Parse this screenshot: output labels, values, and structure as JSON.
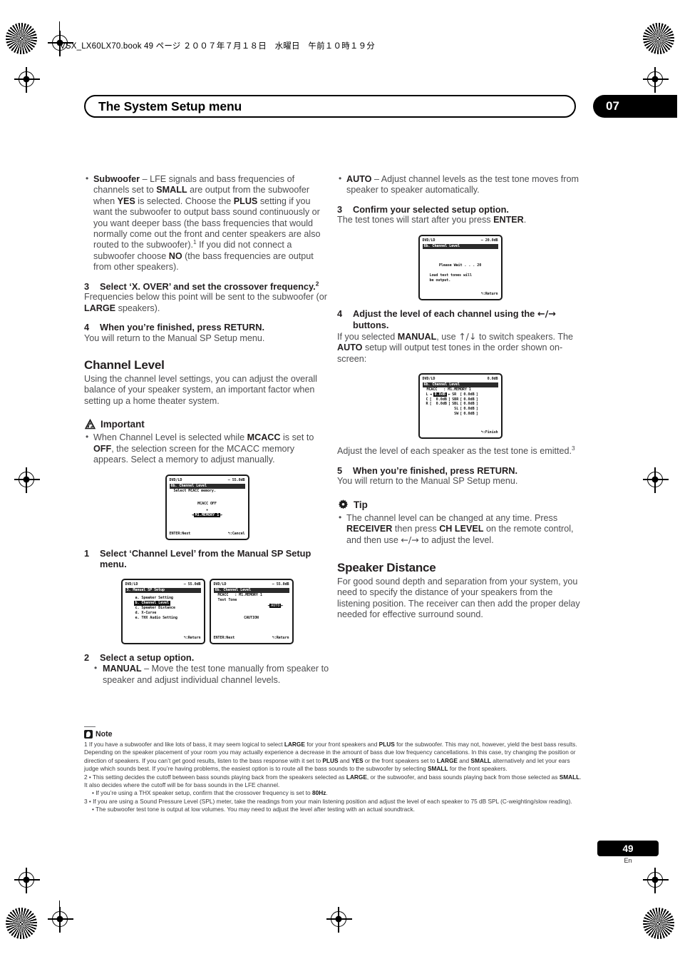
{
  "runhead": "VSX_LX60LX70.book 49 ページ ２００７年７月１８日　水曜日　午前１０時１９分",
  "header": {
    "title": "The System Setup menu",
    "chapter": "07"
  },
  "left_column": {
    "subwoofer_bullet": {
      "term": "Subwoofer",
      "text_1": " – LFE signals and bass frequencies of channels set to ",
      "b_small": "SMALL",
      "text_2": " are output from the subwoofer when ",
      "b_yes": "YES",
      "text_3": " is selected. Choose the ",
      "b_plus": "PLUS",
      "text_4": " setting if you want the subwoofer to output bass sound continuously or you want deeper bass (the bass frequencies that would normally come out the front and center speakers are also routed to the subwoofer).",
      "sup_1": "1",
      "text_5": " If you did not connect a subwoofer choose ",
      "b_no": "NO",
      "text_6": " (the bass frequencies are output from other speakers)."
    },
    "step3": {
      "num": "3",
      "title_a": "Select ‘X. OVER’ and set the crossover frequency.",
      "sup": "2",
      "body_1": "Frequencies below this point will be sent to the subwoofer (or ",
      "b_large": "LARGE",
      "body_2": " speakers)."
    },
    "step4": {
      "num": "4",
      "title": "When you’re finished, press RETURN.",
      "body": "You will return to the Manual SP Setup menu."
    },
    "channel_level": {
      "heading": "Channel Level",
      "body": "Using the channel level settings, you can adjust the overall balance of your speaker system, an important factor when setting up a home theater system."
    },
    "important": {
      "label": "Important",
      "text_1": "When Channel Level is selected while ",
      "b_mcacc": "MCACC",
      "text_2": " is set to ",
      "b_off": "OFF",
      "text_3": ", the selection screen for the MCACC memory appears. Select a memory to adjust manually."
    },
    "step1": {
      "num": "1",
      "title": "Select ‘Channel Level’ from the Manual SP Setup menu."
    },
    "step2": {
      "num": "2",
      "title": "Select a setup option.",
      "bullet_term": "MANUAL",
      "bullet_text": " – Move the test tone manually from speaker to speaker and adjust individual channel levels."
    }
  },
  "right_column": {
    "auto_bullet": {
      "term": "AUTO",
      "text": " – Adjust channel levels as the test tone moves from speaker to speaker automatically."
    },
    "step3": {
      "num": "3",
      "title": "Confirm your selected setup option.",
      "body_1": "The test tones will start after you press ",
      "b_enter": "ENTER",
      "body_2": "."
    },
    "step4": {
      "num": "4",
      "title_1": "Adjust the level of each channel using the ",
      "arrows": "←/→",
      "title_2": " buttons.",
      "body_1": "If you selected ",
      "b_manual": "MANUAL",
      "body_2": ", use ",
      "arrows_ud": "↑/↓",
      "body_3": " to switch speakers. The ",
      "b_auto": "AUTO",
      "body_4": " setup will output test tones in the order shown on-screen:"
    },
    "after_osd": {
      "text": "Adjust the level of each speaker as the test tone is emitted.",
      "sup": "3"
    },
    "step5": {
      "num": "5",
      "title": "When you’re finished, press RETURN.",
      "body": "You will return to the Manual SP Setup menu."
    },
    "tip": {
      "label": "Tip",
      "text_1": "The channel level can be changed at any time. Press ",
      "b_receiver": "RECEIVER",
      "text_2": " then press ",
      "b_chlevel": "CH LEVEL",
      "text_3": " on the remote control, and then use ",
      "arrows": "←/→",
      "text_4": " to adjust the level."
    },
    "speaker_distance": {
      "heading": "Speaker Distance",
      "body": "For good sound depth and separation from your system, you need to specify the distance of your speakers from the listening position. The receiver can then add the proper delay needed for effective surround sound."
    }
  },
  "osd": {
    "mcacc_memory": {
      "source": "DVD/LD",
      "level": "– 55.0dB",
      "titlebar": "6b. Channel Level",
      "subtitle": "Select MCACC memory.",
      "value_off": "MCACC OFF",
      "down_arrow": "▼",
      "selected": "M1.MEMORY 1",
      "left_mark": "◄",
      "right_mark": "►",
      "foot_left": "ENTER:Next",
      "foot_right": "↰:Cancel"
    },
    "manual_sp_setup": {
      "source": "DVD/LD",
      "level": "– 55.0dB",
      "titlebar": "3. Manual SP Setup",
      "items": [
        "a. Speaker Setting",
        "b. Channel Level",
        "c. Speaker Distance",
        "d. X-Curve",
        "e. THX Audio Setting"
      ],
      "selected_index": 1,
      "foot_right": "↰:Return"
    },
    "test_tone_select": {
      "source": "DVD/LD",
      "level": "– 55.0dB",
      "titlebar": "6b. Channel Level",
      "mcacc_line": "MCACC   : M1.MEMORY 1",
      "test_tone_label": "Test Tone",
      "test_tone_value": "AUTO",
      "left_mark": "◄",
      "right_mark": "►",
      "caution": "CAUTION",
      "foot_left": "ENTER:Next",
      "foot_right": "↰:Return"
    },
    "please_wait": {
      "source": "DVD/LD",
      "level": "– 20.0dB",
      "titlebar": "6b. Channel Level",
      "wait_line": "Please Wait . . . 20",
      "info_line_1": "Loud test tones will",
      "info_line_2": "be output.",
      "foot_right": "↰:Return"
    },
    "channel_levels": {
      "source": "DVD/LD",
      "level": "0.0dB",
      "titlebar": "6b. Channel Level",
      "mcacc_line": "MCACC   : M1.MEMORY 1",
      "left_rows": [
        {
          "label": "L",
          "value": "0.0dB",
          "selected": true
        },
        {
          "label": "C",
          "value": "0.0dB",
          "selected": false
        },
        {
          "label": "R",
          "value": "0.0dB",
          "selected": false
        }
      ],
      "right_rows": [
        {
          "label": "SR",
          "value": "0.0dB"
        },
        {
          "label": "SBR",
          "value": "0.0dB"
        },
        {
          "label": "SBL",
          "value": "0.0dB"
        },
        {
          "label": "SL",
          "value": "0.0dB"
        },
        {
          "label": "SW",
          "value": "0.0dB"
        }
      ],
      "bracket_open": "[",
      "bracket_close": "]",
      "left_mark": "◄",
      "right_mark": "►",
      "foot_right": "↰:Finish"
    }
  },
  "footnotes": {
    "label": "Note",
    "n1_a": "1 If you have a subwoofer and like lots of bass, it may seem logical to select ",
    "n1_large": "LARGE",
    "n1_b": " for your front speakers and ",
    "n1_plus": "PLUS",
    "n1_c": " for the subwoofer. This may not, however, yield the best bass results. Depending on the speaker placement of your room you may actually experience a decrease in the amount of bass due low frequency cancellations. In this case, try changing the position or direction of speakers. If you can’t get good results, listen to the bass response with it set to ",
    "n1_plus2": "PLUS",
    "n1_d": " and ",
    "n1_yes": "YES",
    "n1_e": " or the front speakers set to ",
    "n1_large2": "LARGE",
    "n1_f": " and ",
    "n1_small": "SMALL",
    "n1_g": " alternatively and let your ears judge which sounds best. If you’re having problems, the easiest option is to route all the bass sounds to the subwoofer by selecting ",
    "n1_small2": "SMALL",
    "n1_h": " for the front speakers.",
    "n2_a": "2 • This setting decides the cutoff between bass sounds playing back from the speakers selected as ",
    "n2_large": "LARGE",
    "n2_b": ", or the subwoofer, and bass sounds playing back from those selected as ",
    "n2_small": "SMALL",
    "n2_c": ". It also decides where the cutoff will be for bass sounds in the LFE channel.",
    "n2_sub_a": "• If you’re using a THX speaker setup, confirm that the crossover frequency is set to ",
    "n2_sub_hz": "80Hz",
    "n2_sub_b": ".",
    "n3": "3 • If you are using a Sound Pressure Level (SPL) meter, take the readings from your main listening position and adjust the level of each speaker to 75 dB SPL (C-weighting/slow reading).",
    "n3_sub": "• The subwoofer test tone is output at low volumes. You may need to adjust the level after testing with an actual soundtrack."
  },
  "page_number": "49",
  "page_lang": "En"
}
